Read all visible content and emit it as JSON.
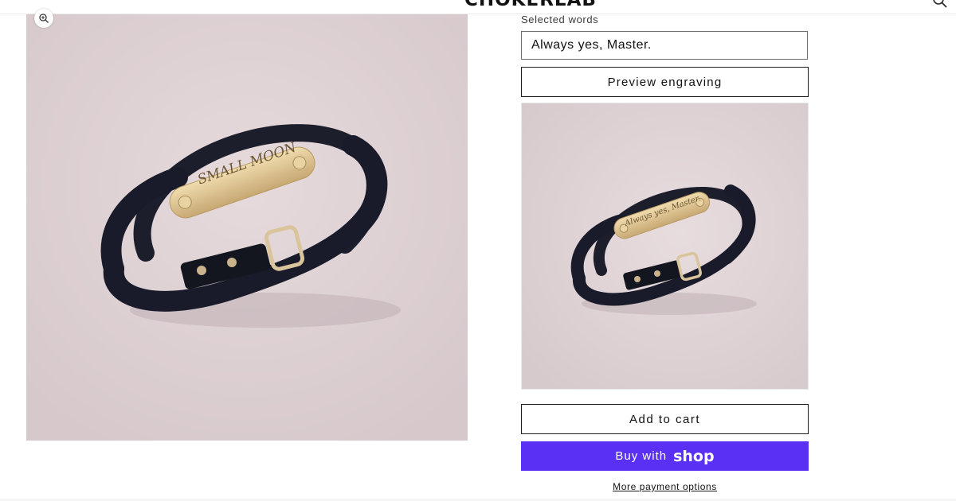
{
  "header": {
    "logo_text": "CHOKERLAB",
    "search_icon": "search-icon"
  },
  "gallery": {
    "main_image": {
      "engraving": "SMALL MOON",
      "background": "#ddd0d2",
      "strap_color": "#191b2a",
      "plate_color": "#d8c08e"
    },
    "zoom_icon": "zoom-in-icon"
  },
  "product": {
    "field_label": "Selected words",
    "engraving_value": "Always yes, Master.",
    "preview_label": "Preview engraving",
    "preview_image": {
      "engraving": "Always yes, Master."
    },
    "add_to_cart_label": "Add to cart",
    "buy_with_label": "Buy with",
    "buy_brand": "shop",
    "buy_button_color": "#5a31f4",
    "more_payment_label": "More payment options"
  }
}
